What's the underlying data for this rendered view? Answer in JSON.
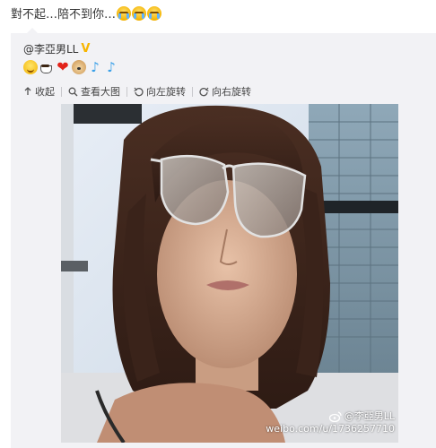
{
  "post": {
    "text": "對不起…陪不到你…",
    "emoji_count_names": [
      "crying-face-icon",
      "crying-face-icon",
      "crying-face-icon"
    ]
  },
  "repost": {
    "author": "@李亞男LL",
    "emoji_names": [
      "smiling-face-icon",
      "coffee-cup-icon",
      "red-heart-icon",
      "dog-face-icon",
      "music-note-icon",
      "music-note-icon"
    ],
    "toolbar": {
      "collapse_label": "收起",
      "view_large_label": "查看大图",
      "rotate_left_label": "向左旋转",
      "rotate_right_label": "向右旋转"
    },
    "watermark": {
      "user": "@李亞男LL",
      "url": "weibo.com/u/1736257710"
    }
  },
  "colors": {
    "repost_bg": "#f2f2f5",
    "vip_badge": "#f7b500",
    "heart": "#e2231a",
    "music_note": "#3aa0e8"
  }
}
